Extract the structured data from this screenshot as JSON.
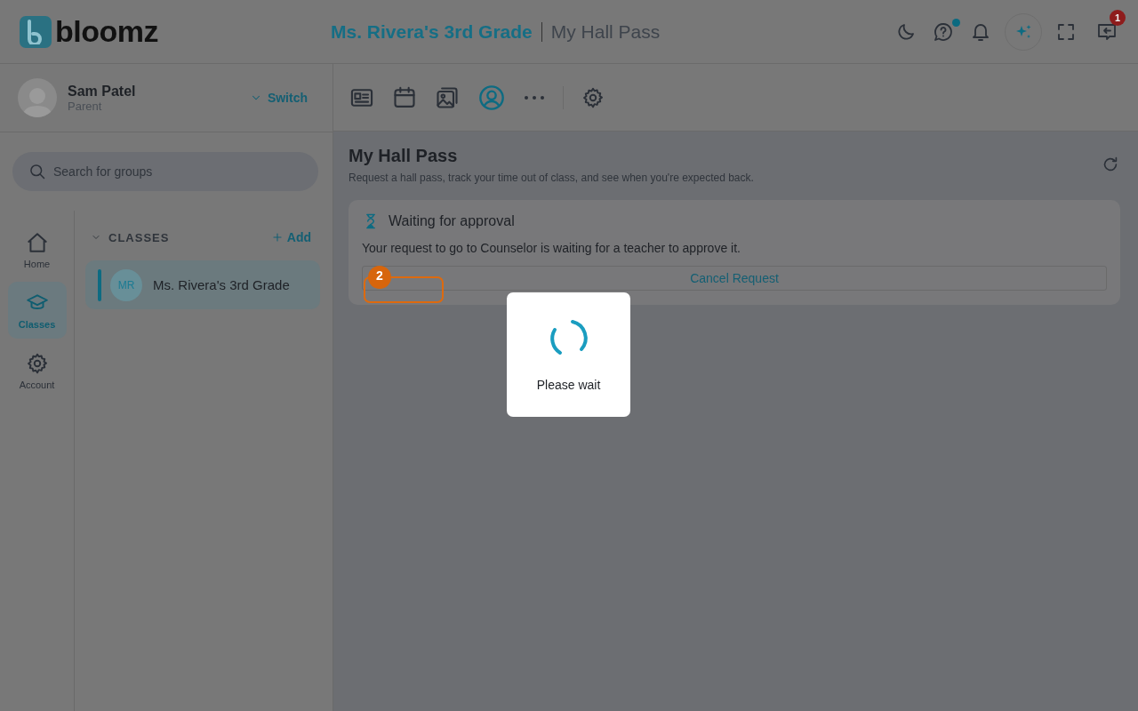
{
  "header": {
    "logo_text": "bloomz",
    "class_title": "Ms. Rivera's 3rd Grade",
    "page_title": "My Hall Pass",
    "help_has_dot": true,
    "inbox_badge": "1"
  },
  "profile": {
    "name": "Sam Patel",
    "role": "Parent",
    "switch_label": "Switch"
  },
  "search": {
    "placeholder": "Search for groups"
  },
  "nav": [
    {
      "kind": "home",
      "label": "Home",
      "selected": false
    },
    {
      "kind": "classes",
      "label": "Classes",
      "selected": true
    },
    {
      "kind": "account",
      "label": "Account",
      "selected": false
    }
  ],
  "classes": {
    "heading": "CLASSES",
    "add_label": "Add",
    "items": [
      {
        "initials": "MR",
        "name": "Ms. Rivera's 3rd Grade",
        "selected": true
      }
    ]
  },
  "toolbar": [
    {
      "kind": "news",
      "selected": false
    },
    {
      "kind": "calendar",
      "selected": false
    },
    {
      "kind": "photos",
      "selected": false
    },
    {
      "kind": "profile",
      "selected": true
    },
    {
      "kind": "more",
      "selected": false
    },
    {
      "kind": "settings",
      "selected": false
    }
  ],
  "page": {
    "title": "My Hall Pass",
    "subtitle": "Request a hall pass, track your time out of class, and see when you're expected back.",
    "card": {
      "status": "Waiting for approval",
      "message": "Your request to go to Counselor is waiting for a teacher to approve it.",
      "cancel_label": "Cancel Request"
    }
  },
  "modal": {
    "text": "Please wait"
  },
  "annotation": {
    "number": "2"
  }
}
